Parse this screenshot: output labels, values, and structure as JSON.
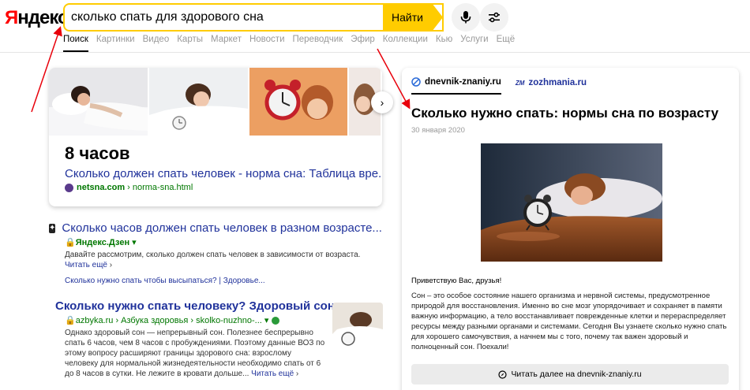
{
  "header": {
    "logo_text": "Яндекс",
    "search_query": "сколько спать для здорового сна",
    "search_button": "Найти"
  },
  "tabs": [
    "Поиск",
    "Картинки",
    "Видео",
    "Карты",
    "Маркет",
    "Новости",
    "Переводчик",
    "Эфир",
    "Коллекции",
    "Кью",
    "Услуги",
    "Ещё"
  ],
  "answer_card": {
    "answer": "8 часов",
    "link": "Сколько должен спать человек - норма сна: Таблица вре...",
    "domain": "netsna.com",
    "path": "› norma-sna.html"
  },
  "results": [
    {
      "title": "Сколько часов должен спать человек в разном возрасте...",
      "source": "Яндекс.Дзен",
      "desc": "Давайте рассмотрим, сколько должен спать человек в зависимости от возраста.",
      "more": "Читать ещё",
      "sub": "Сколько нужно спать чтобы высыпаться? | Здоровье..."
    },
    {
      "title": "Сколько нужно спать человеку? Здоровый сон...",
      "source": "azbyka.ru › Азбука здоровья › skolko-nuzhno-...",
      "desc": "Однако здоровый сон — непрерывный сон. Полезнее беспрерывно спать 6 часов, чем 8 часов с пробуждениями. Поэтому данные ВОЗ по этому вопросу расширяют границы здорового сна: взрослому человеку для нормальной жизнедеятельности необходимо спать от 6 до 8 часов в сутки. Не лежите в кровати дольше...",
      "more": "Читать ещё"
    }
  ],
  "panel": {
    "tab1": "dnevnik-znaniy.ru",
    "tab2": "zozhmania.ru",
    "tab2_icon": "ZM",
    "title": "Сколько нужно спать: нормы сна по возрасту",
    "date": "30 января 2020",
    "greeting": "Приветствую Вас, друзья!",
    "text": "Сон – это особое состояние нашего организма и нервной системы, предусмотренное природой для восстановления. Именно во сне мозг упорядочивает и сохраняет в памяти важную информацию, а тело восстанавливает поврежденные клетки и перераспределяет ресурсы между разными органами и системами. Сегодня Вы узнаете сколько нужно спать для хорошего самочувствия, а начнем мы с того, почему так важен здоровый и полноценный сон. Поехали!",
    "read_more": "Читать далее на dnevnik-znaniy.ru"
  },
  "colors": {
    "accent": "#ffcc00",
    "link": "#20329b",
    "source": "#007700",
    "annotation": "#e8000b"
  }
}
